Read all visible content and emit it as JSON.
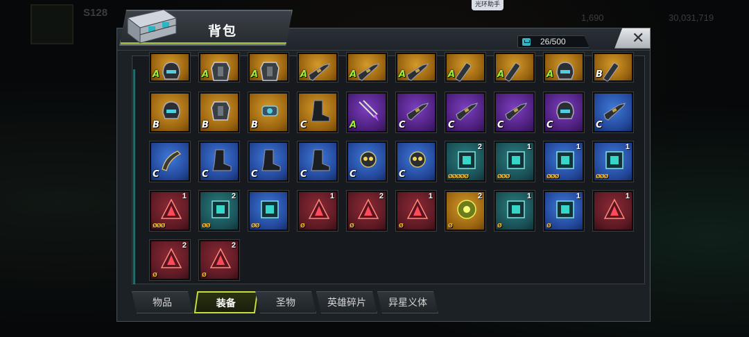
{
  "background": {
    "server_label": "S128",
    "stat_small_1": "1,690",
    "stat_small_2": "30,031,719",
    "helper_button": "光环助手"
  },
  "header": {
    "title": "背包",
    "capacity": "26/500",
    "close_label": "✕"
  },
  "grid": {
    "rows": [
      [
        {
          "tier": "gold",
          "grade": "A",
          "icon": "helmet-icon"
        },
        {
          "tier": "gold",
          "grade": "A",
          "icon": "armor-icon"
        },
        {
          "tier": "gold",
          "grade": "A",
          "icon": "armor-icon"
        },
        {
          "tier": "gold",
          "grade": "A",
          "icon": "rifle-icon"
        },
        {
          "tier": "gold",
          "grade": "A",
          "icon": "rifle-icon"
        },
        {
          "tier": "gold",
          "grade": "A",
          "icon": "rifle-icon"
        },
        {
          "tier": "gold",
          "grade": "A",
          "icon": "barrel-icon"
        },
        {
          "tier": "gold",
          "grade": "A",
          "icon": "barrel-icon"
        },
        {
          "tier": "gold",
          "grade": "A",
          "icon": "helmet-icon"
        },
        {
          "tier": "gold",
          "grade": "B",
          "icon": "barrel-icon"
        }
      ],
      [
        {
          "tier": "gold",
          "grade": "B",
          "icon": "helmet-icon"
        },
        {
          "tier": "gold",
          "grade": "B",
          "icon": "armor-icon"
        },
        {
          "tier": "gold",
          "grade": "B",
          "icon": "gauntlet-icon"
        },
        {
          "tier": "gold",
          "grade": "C",
          "icon": "boot-icon"
        },
        {
          "tier": "purple",
          "grade": "A",
          "icon": "arrows-icon"
        },
        {
          "tier": "purple",
          "grade": "C",
          "icon": "rifle-icon"
        },
        {
          "tier": "purple",
          "grade": "C",
          "icon": "rifle-icon"
        },
        {
          "tier": "purple",
          "grade": "C",
          "icon": "rifle-icon"
        },
        {
          "tier": "purple",
          "grade": "C",
          "icon": "helmet-icon"
        },
        {
          "tier": "blue",
          "grade": "C",
          "icon": "rifle-icon"
        }
      ],
      [
        {
          "tier": "blue",
          "grade": "C",
          "icon": "horn-icon"
        },
        {
          "tier": "blue",
          "grade": "C",
          "icon": "boot-icon"
        },
        {
          "tier": "blue",
          "grade": "C",
          "icon": "boot-icon"
        },
        {
          "tier": "blue",
          "grade": "C",
          "icon": "boot-icon"
        },
        {
          "tier": "blue",
          "grade": "C",
          "icon": "skull-icon"
        },
        {
          "tier": "blue",
          "grade": "C",
          "icon": "skull-icon"
        },
        {
          "tier": "teal",
          "count": "2",
          "sockets": "ØØØØØ",
          "icon": "chip-icon"
        },
        {
          "tier": "teal",
          "count": "1",
          "sockets": "ØØØ",
          "icon": "chip-icon"
        },
        {
          "tier": "blue",
          "count": "1",
          "sockets": "ØØØ",
          "icon": "chip-icon"
        },
        {
          "tier": "blue",
          "count": "1",
          "sockets": "ØØØ",
          "icon": "chip-icon"
        }
      ],
      [
        {
          "tier": "red",
          "count": "1",
          "sockets": "ØØØ",
          "icon": "crystal-icon"
        },
        {
          "tier": "teal",
          "count": "2",
          "sockets": "ØØ",
          "icon": "chip-icon"
        },
        {
          "tier": "blue",
          "count": "",
          "sockets": "ØØ",
          "icon": "chip-icon"
        },
        {
          "tier": "red",
          "count": "1",
          "sockets": "Ø",
          "icon": "crystal-icon"
        },
        {
          "tier": "red",
          "count": "2",
          "sockets": "Ø",
          "icon": "crystal-icon"
        },
        {
          "tier": "red",
          "count": "1",
          "sockets": "Ø",
          "icon": "crystal-icon"
        },
        {
          "tier": "gold",
          "count": "2",
          "sockets": "Ø",
          "icon": "disc-icon"
        },
        {
          "tier": "teal",
          "count": "1",
          "sockets": "Ø",
          "icon": "chip-icon"
        },
        {
          "tier": "blue",
          "count": "1",
          "sockets": "Ø",
          "icon": "chip-icon"
        },
        {
          "tier": "red",
          "count": "1",
          "sockets": "",
          "icon": "crystal-icon"
        }
      ],
      [
        {
          "tier": "red",
          "count": "2",
          "sockets": "Ø",
          "icon": "crystal-icon"
        },
        {
          "tier": "red",
          "count": "2",
          "sockets": "Ø",
          "icon": "crystal-icon"
        }
      ]
    ]
  },
  "tabs": [
    {
      "label": "物品",
      "active": false
    },
    {
      "label": "装备",
      "active": true
    },
    {
      "label": "圣物",
      "active": false
    },
    {
      "label": "英雄碎片",
      "active": false
    },
    {
      "label": "异星义体",
      "active": false
    }
  ],
  "colors": {
    "accent": "#c6e036",
    "gold_tier": "#d49a2a",
    "purple_tier": "#7d3fc0",
    "blue_tier": "#3f7ad8",
    "red_tier": "#8c2a36",
    "teal_tier": "#2a7f7e"
  }
}
